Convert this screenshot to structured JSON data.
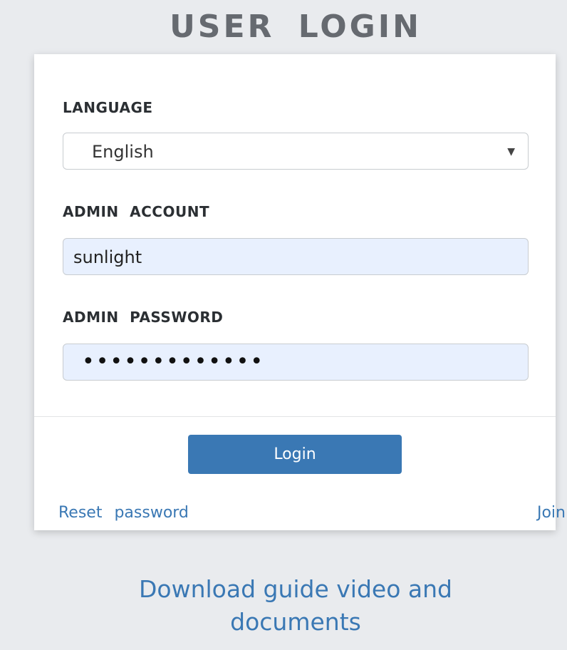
{
  "header": {
    "title": "USER LOGIN"
  },
  "form": {
    "language": {
      "label": "LANGUAGE",
      "selected": "English",
      "caret_icon": "caret-down-icon"
    },
    "account": {
      "label": "ADMIN ACCOUNT",
      "value": "sunlight"
    },
    "password": {
      "label": "ADMIN PASSWORD",
      "masked_value": "•••••••••••••"
    },
    "login_label": "Login",
    "reset_label": "Reset password",
    "join_label": "Join"
  },
  "footer": {
    "guide_line1": "Download guide video and",
    "guide_line2": "documents"
  },
  "colors": {
    "background": "#e9ebee",
    "card": "#ffffff",
    "accent": "#3a78b4",
    "input_fill": "#e8f0fe",
    "title": "#666a70"
  }
}
